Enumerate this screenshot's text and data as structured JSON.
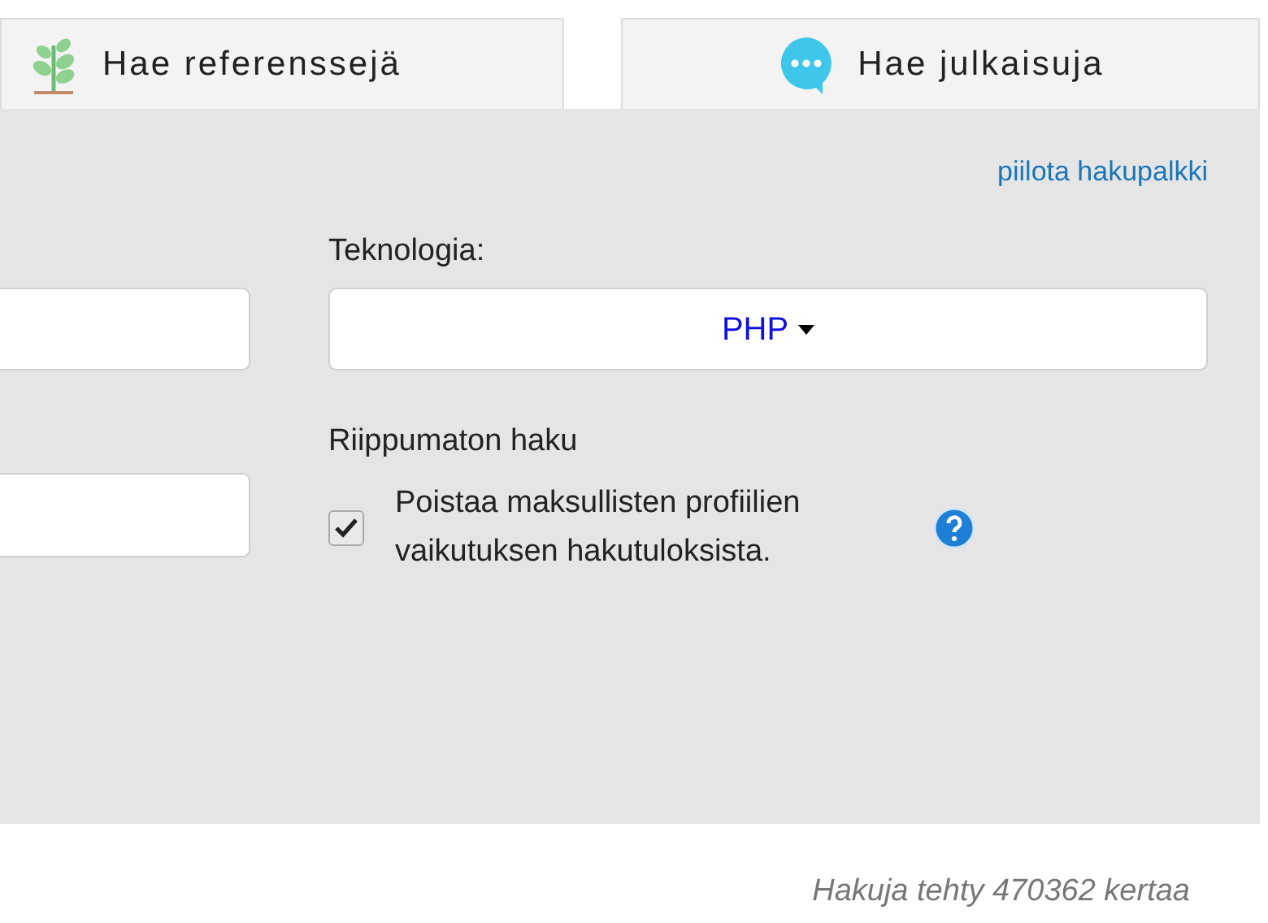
{
  "tabs": [
    {
      "label": "Hae referenssejä",
      "kind": "plant"
    },
    {
      "label": "Hae julkaisuja",
      "kind": "chat"
    }
  ],
  "hide_link": "piilota hakupalkki",
  "technology": {
    "label": "Teknologia:",
    "value": "PHP"
  },
  "independent": {
    "label": "Riippumaton haku",
    "checked": true,
    "text": "Poistaa maksullisten profiilien vaikutuksen hakutuloksista."
  },
  "footer": "Hakuja tehty 470362 kertaa"
}
